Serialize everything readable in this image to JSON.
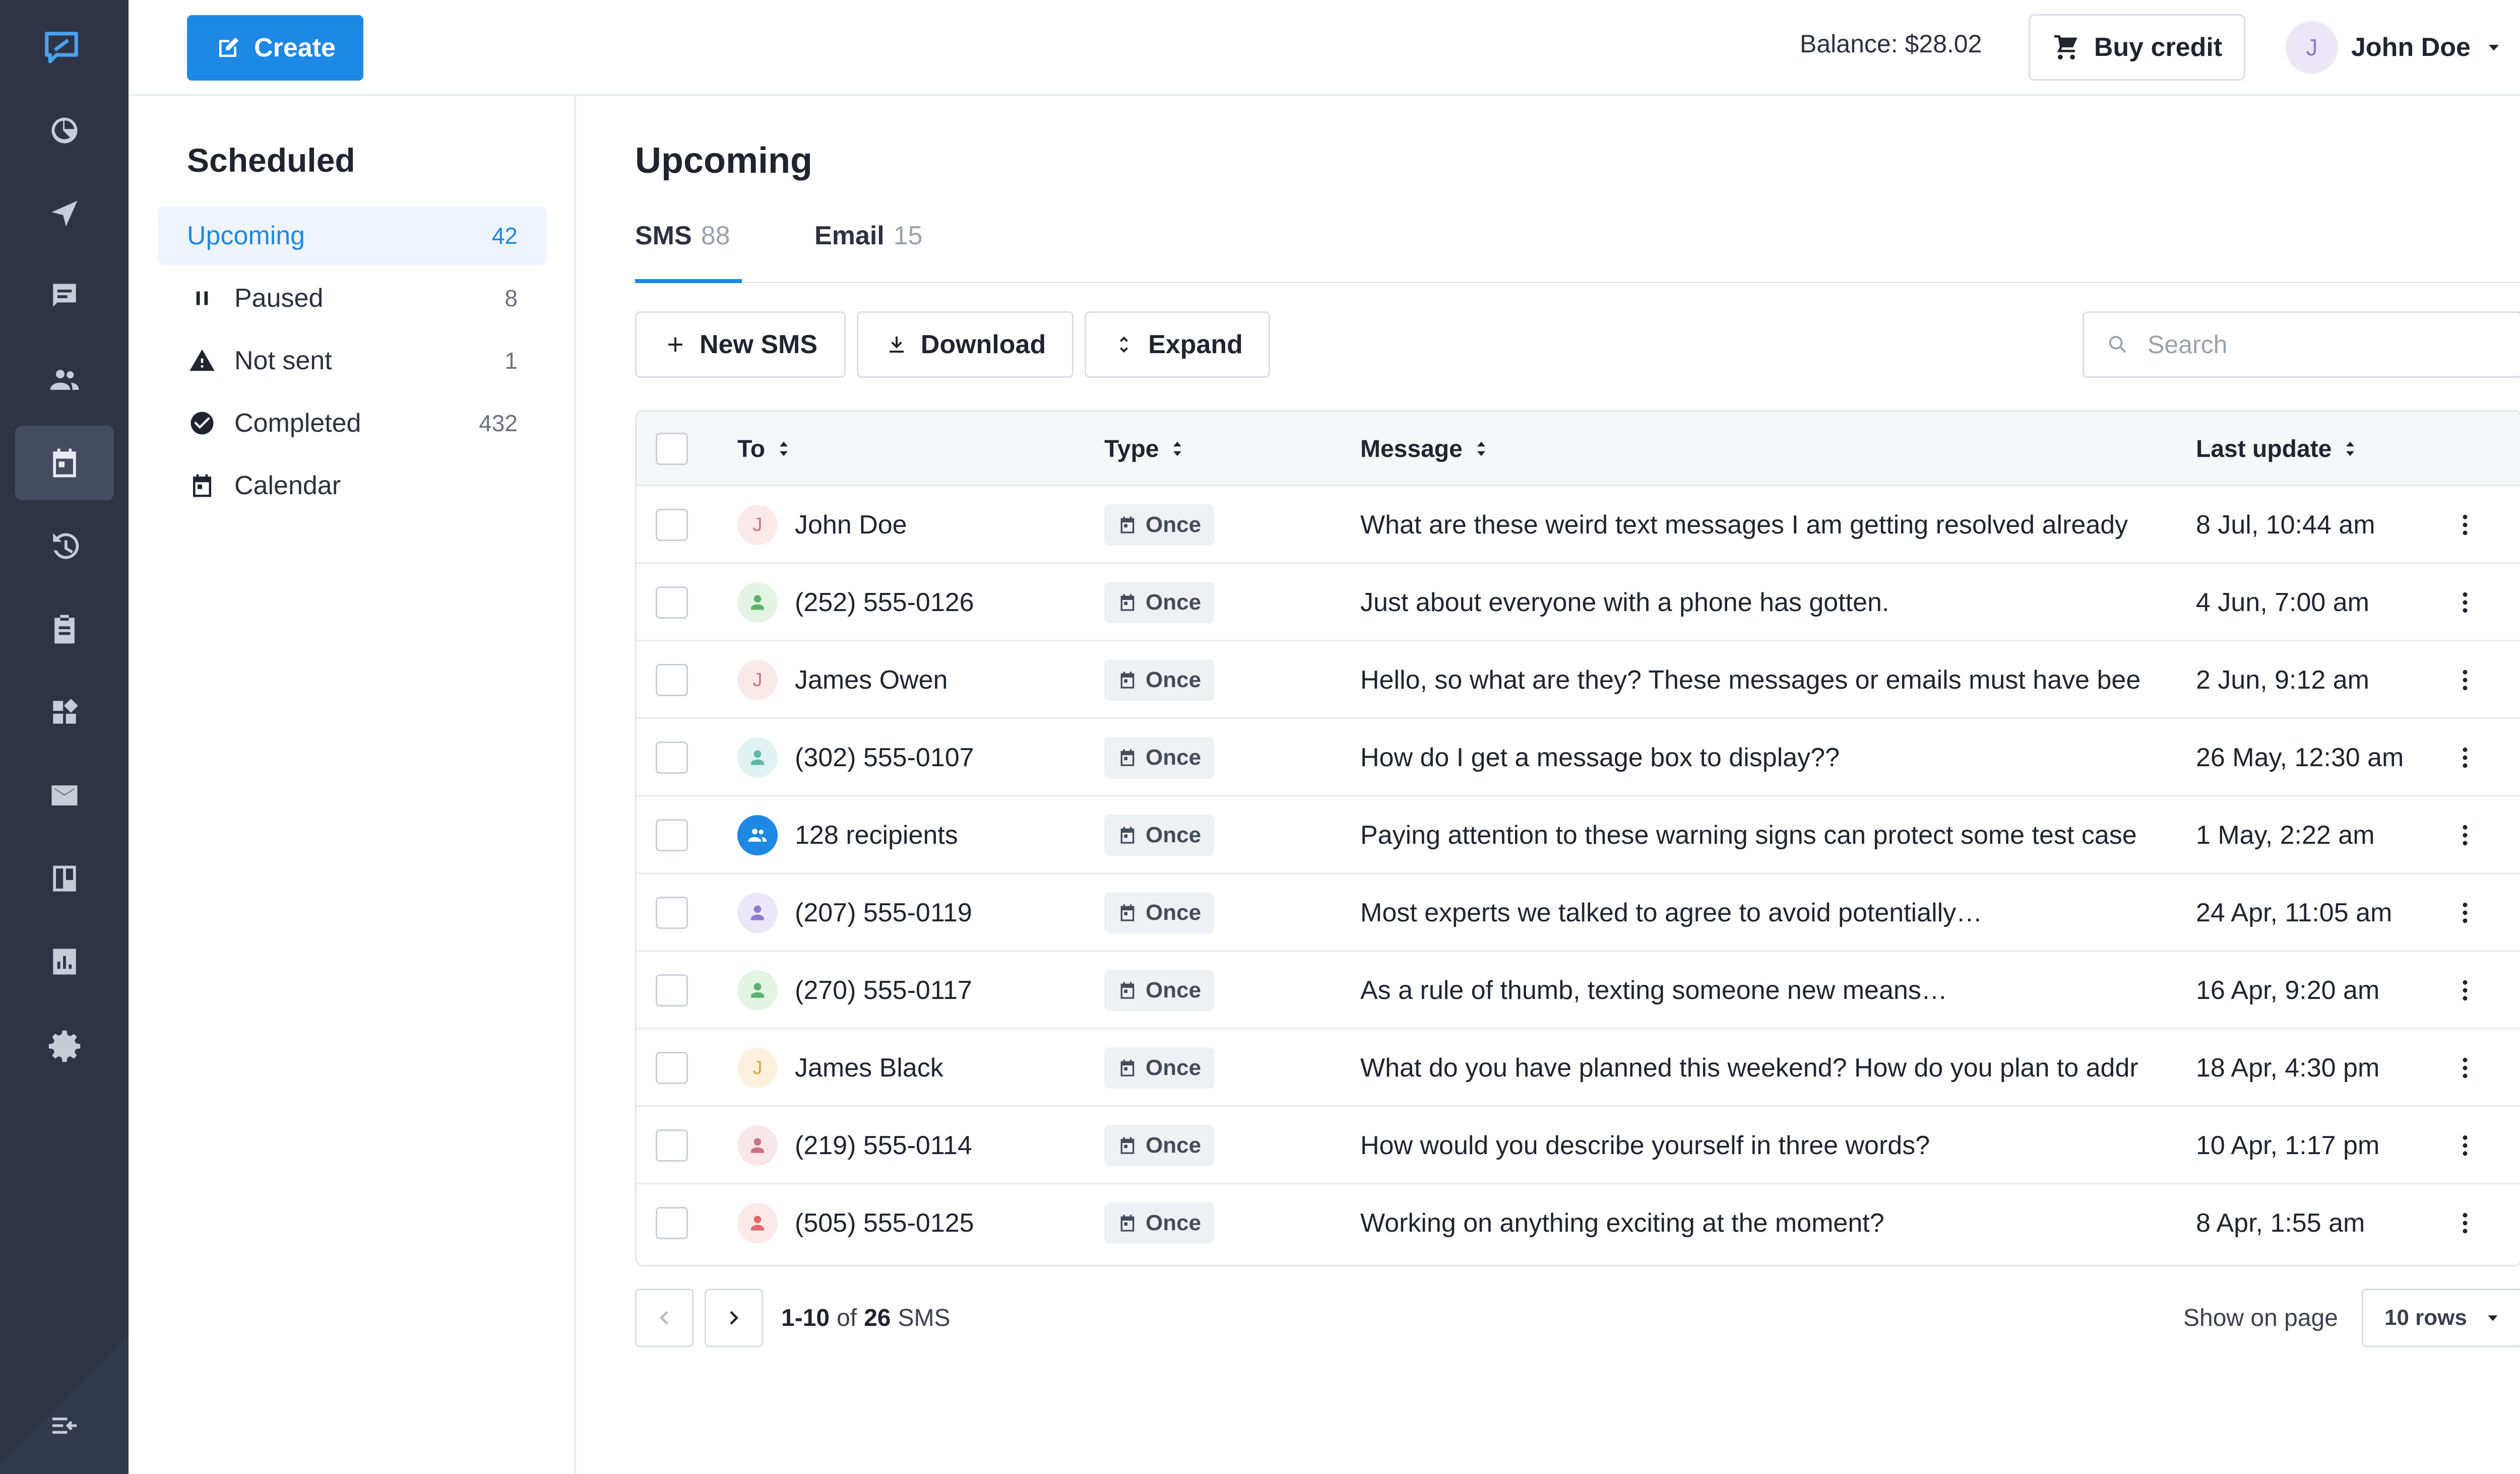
{
  "app": {
    "brand_color": "#1e88e5",
    "rail_color": "#2e3446"
  },
  "rail": {
    "items": [
      {
        "icon": "dashboard-icon"
      },
      {
        "icon": "send-icon"
      },
      {
        "icon": "chat-icon"
      },
      {
        "icon": "contacts-icon"
      },
      {
        "icon": "calendar-icon",
        "active": true
      },
      {
        "icon": "history-icon"
      },
      {
        "icon": "clipboard-icon"
      },
      {
        "icon": "apps-icon"
      },
      {
        "icon": "mail-icon"
      },
      {
        "icon": "board-icon"
      },
      {
        "icon": "analytics-icon"
      },
      {
        "icon": "settings-icon"
      }
    ],
    "collapse_icon": "collapse-icon"
  },
  "topbar": {
    "create_label": "Create",
    "balance": "Balance: $28.02",
    "buy_credit_label": "Buy credit",
    "user_initial": "J",
    "user_name": "John Doe"
  },
  "subnav": {
    "title": "Scheduled",
    "items": [
      {
        "label": "Upcoming",
        "count": "42",
        "active": true
      },
      {
        "label": "Paused",
        "count": "8",
        "icon": "pause-icon"
      },
      {
        "label": "Not sent",
        "count": "1",
        "icon": "warning-icon"
      },
      {
        "label": "Completed",
        "count": "432",
        "icon": "check-circle-icon"
      },
      {
        "label": "Calendar",
        "count": "",
        "icon": "calendar-icon"
      }
    ]
  },
  "main": {
    "title": "Upcoming",
    "tabs": [
      {
        "label": "SMS",
        "count": "88",
        "active": true
      },
      {
        "label": "Email",
        "count": "15"
      }
    ],
    "toolbar": {
      "new_label": "New SMS",
      "download_label": "Download",
      "expand_label": "Expand",
      "search_placeholder": "Search"
    },
    "columns": {
      "to": "To",
      "type": "Type",
      "message": "Message",
      "last_update": "Last update"
    },
    "rows": [
      {
        "to": "John Doe",
        "avatar": "J",
        "avatar_kind": "initial",
        "avatar_bg": "#fbe9ea",
        "avatar_fg": "#d9707a",
        "type": "Once",
        "message": "What are these weird text messages I am getting resolved already",
        "updated": "8 Jul, 10:44 am"
      },
      {
        "to": "(252) 555-0126",
        "avatar_kind": "person",
        "avatar_bg": "#e3f3e4",
        "avatar_fg": "#5bb36a",
        "type": "Once",
        "message": "Just about everyone with a phone has gotten.",
        "updated": "4 Jun, 7:00 am"
      },
      {
        "to": "James Owen",
        "avatar": "J",
        "avatar_kind": "initial",
        "avatar_bg": "#fbe9ea",
        "avatar_fg": "#d9707a",
        "type": "Once",
        "message": "Hello, so what are they? These messages or emails must have bee",
        "updated": "2 Jun, 9:12 am"
      },
      {
        "to": "(302) 555-0107",
        "avatar_kind": "person",
        "avatar_bg": "#e0f2f1",
        "avatar_fg": "#5fb6ad",
        "type": "Once",
        "message": "How do I get a message box to display??",
        "updated": "26 May, 12:30 am"
      },
      {
        "to": "128 recipients",
        "avatar_kind": "group",
        "avatar_bg": "#1e88e5",
        "avatar_fg": "#ffffff",
        "type": "Once",
        "message": "Paying attention to these warning signs can protect some test case",
        "updated": "1 May, 2:22 am"
      },
      {
        "to": "(207) 555-0119",
        "avatar_kind": "person",
        "avatar_bg": "#ebe7f7",
        "avatar_fg": "#8b7bd1",
        "type": "Once",
        "message": "Most experts we talked to agree to avoid potentially…",
        "updated": "24 Apr, 11:05 am"
      },
      {
        "to": "(270) 555-0117",
        "avatar_kind": "person",
        "avatar_bg": "#e3f3e4",
        "avatar_fg": "#5bb36a",
        "type": "Once",
        "message": "As a rule of thumb, texting someone new means…",
        "updated": "16 Apr, 9:20 am"
      },
      {
        "to": "James Black",
        "avatar": "J",
        "avatar_kind": "initial",
        "avatar_bg": "#fdf1dd",
        "avatar_fg": "#e0a23a",
        "type": "Once",
        "message": "What do you have planned this weekend? How do you plan to addr",
        "updated": "18 Apr, 4:30 pm"
      },
      {
        "to": "(219) 555-0114",
        "avatar_kind": "person",
        "avatar_bg": "#f8e6e8",
        "avatar_fg": "#c9727d",
        "type": "Once",
        "message": "How would you describe yourself in three words?",
        "updated": "10 Apr, 1:17 pm"
      },
      {
        "to": "(505) 555-0125",
        "avatar_kind": "person",
        "avatar_bg": "#fde8e8",
        "avatar_fg": "#e0686a",
        "type": "Once",
        "message": "Working on anything exciting at the moment?",
        "updated": "8 Apr, 1:55 am"
      }
    ],
    "pagination": {
      "range": "1-10",
      "of": "of",
      "total": "26",
      "unit": "SMS",
      "show_label": "Show on page",
      "rows_value": "10 rows"
    }
  }
}
